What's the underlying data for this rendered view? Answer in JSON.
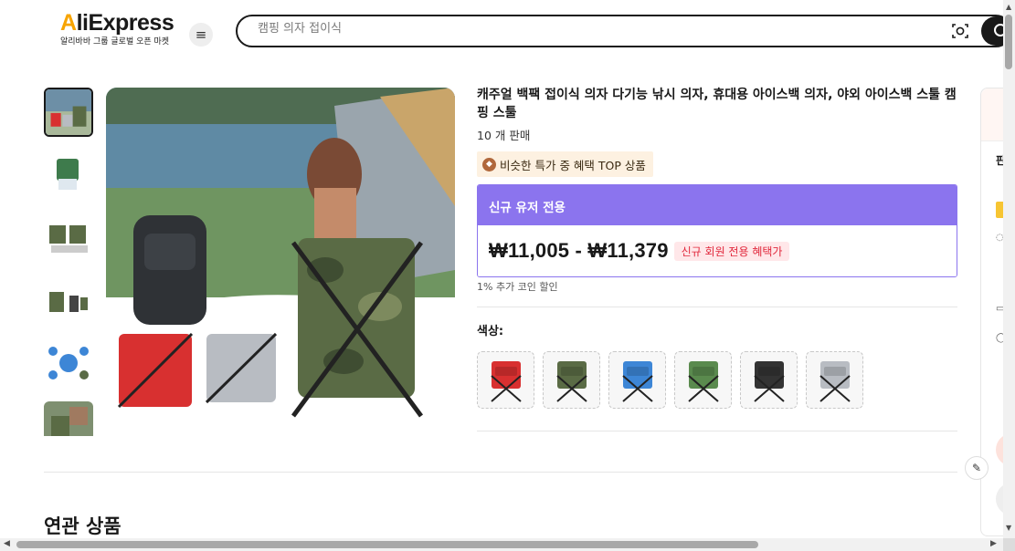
{
  "header": {
    "logo_text_pre": "A",
    "logo_text_rest": "liExpress",
    "logo_sub": "알리바바 그룹 글로벌 오픈 마켓",
    "menu_icon": "≡",
    "search_placeholder": "캠핑 의자 접이식"
  },
  "product": {
    "title": "캐주얼 백팩 접이식 의자 다기능 낚시 의자, 휴대용 아이스백 의자, 야외 아이스백 스툴 캠핑 스툴",
    "sold": "10 개 판매",
    "badge": "비슷한 특가 중 혜택 TOP 상품",
    "price_header": "신규 유저 전용",
    "price_range": "₩11,005 - ₩11,379",
    "price_tag": "신규 회원 전용 혜택가",
    "coin_note": "1% 추가 코인 할인",
    "color_label": "색상:",
    "swatch_colors": [
      "#d83030",
      "#5a6b45",
      "#3d86d6",
      "#5a8a4e",
      "#333333",
      "#b8bcc2"
    ]
  },
  "related": {
    "heading": "연관 상품"
  },
  "side": {
    "char": "판"
  },
  "colors": {
    "accent_purple": "#8b74ee",
    "price_tag_red": "#e1283c",
    "logo_accent": "#f7a400"
  }
}
